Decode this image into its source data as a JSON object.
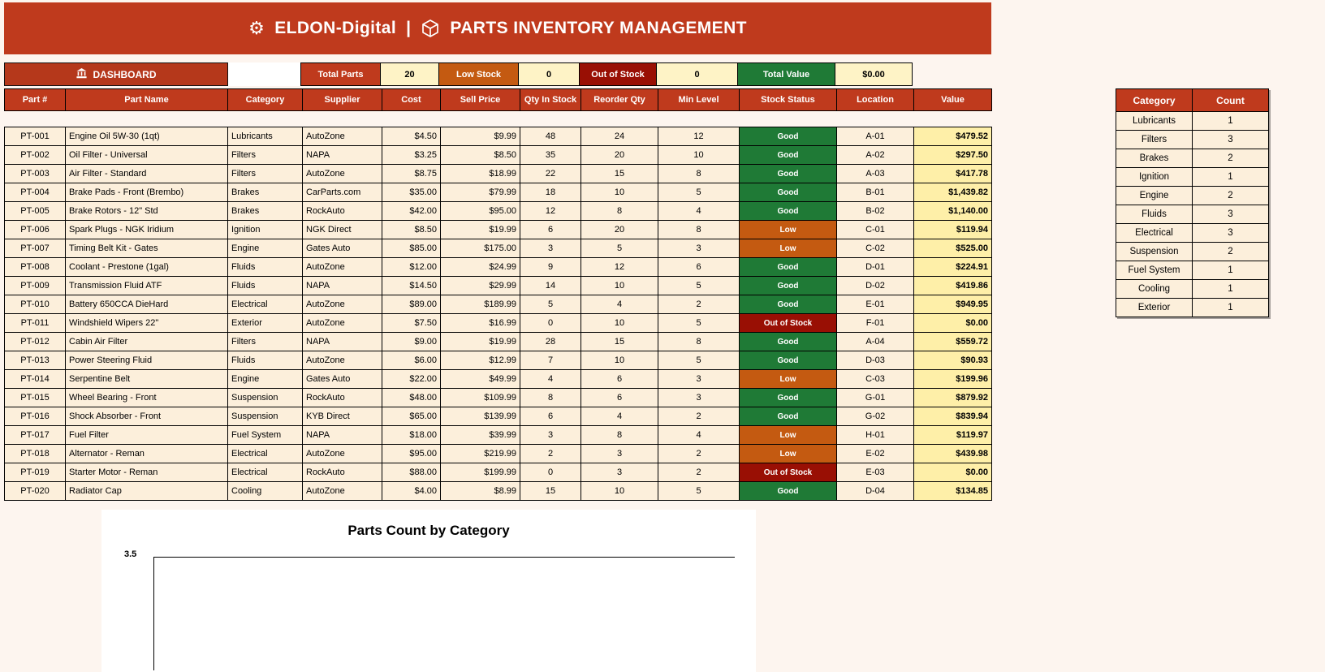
{
  "banner": {
    "app": "ELDON-Digital",
    "sep": "|",
    "title": "PARTS INVENTORY MANAGEMENT"
  },
  "icons": {
    "gear": "⚙",
    "package": "package-cube",
    "dashboard": "bank-building"
  },
  "dashboard": {
    "label": "DASHBOARD"
  },
  "kpis": [
    {
      "label": "Total Parts",
      "value": "20",
      "color": "#bf3a1d"
    },
    {
      "label": "Low Stock",
      "value": "0",
      "color": "#c45a11"
    },
    {
      "label": "Out of Stock",
      "value": "0",
      "color": "#990f04"
    },
    {
      "label": "Total Value",
      "value": "$0.00",
      "color": "#1f7a36"
    }
  ],
  "table": {
    "headers": [
      "Part #",
      "Part Name",
      "Category",
      "Supplier",
      "Cost",
      "Sell Price",
      "Qty In Stock",
      "Reorder Qty",
      "Min Level",
      "Stock Status",
      "Location",
      "Value"
    ],
    "rows": [
      {
        "part": "PT-001",
        "name": "Engine Oil 5W-30 (1qt)",
        "category": "Lubricants",
        "supplier": "AutoZone",
        "cost": "$4.50",
        "sell": "$9.99",
        "qty": 48,
        "reorder": 24,
        "min": 12,
        "status": "Good",
        "location": "A-01",
        "value": "$479.52"
      },
      {
        "part": "PT-002",
        "name": "Oil Filter - Universal",
        "category": "Filters",
        "supplier": "NAPA",
        "cost": "$3.25",
        "sell": "$8.50",
        "qty": 35,
        "reorder": 20,
        "min": 10,
        "status": "Good",
        "location": "A-02",
        "value": "$297.50"
      },
      {
        "part": "PT-003",
        "name": "Air Filter - Standard",
        "category": "Filters",
        "supplier": "AutoZone",
        "cost": "$8.75",
        "sell": "$18.99",
        "qty": 22,
        "reorder": 15,
        "min": 8,
        "status": "Good",
        "location": "A-03",
        "value": "$417.78"
      },
      {
        "part": "PT-004",
        "name": "Brake Pads - Front (Brembo)",
        "category": "Brakes",
        "supplier": "CarParts.com",
        "cost": "$35.00",
        "sell": "$79.99",
        "qty": 18,
        "reorder": 10,
        "min": 5,
        "status": "Good",
        "location": "B-01",
        "value": "$1,439.82"
      },
      {
        "part": "PT-005",
        "name": "Brake Rotors - 12\" Std",
        "category": "Brakes",
        "supplier": "RockAuto",
        "cost": "$42.00",
        "sell": "$95.00",
        "qty": 12,
        "reorder": 8,
        "min": 4,
        "status": "Good",
        "location": "B-02",
        "value": "$1,140.00"
      },
      {
        "part": "PT-006",
        "name": "Spark Plugs - NGK Iridium",
        "category": "Ignition",
        "supplier": "NGK Direct",
        "cost": "$8.50",
        "sell": "$19.99",
        "qty": 6,
        "reorder": 20,
        "min": 8,
        "status": "Low",
        "location": "C-01",
        "value": "$119.94"
      },
      {
        "part": "PT-007",
        "name": "Timing Belt Kit - Gates",
        "category": "Engine",
        "supplier": "Gates Auto",
        "cost": "$85.00",
        "sell": "$175.00",
        "qty": 3,
        "reorder": 5,
        "min": 3,
        "status": "Low",
        "location": "C-02",
        "value": "$525.00"
      },
      {
        "part": "PT-008",
        "name": "Coolant - Prestone (1gal)",
        "category": "Fluids",
        "supplier": "AutoZone",
        "cost": "$12.00",
        "sell": "$24.99",
        "qty": 9,
        "reorder": 12,
        "min": 6,
        "status": "Good",
        "location": "D-01",
        "value": "$224.91"
      },
      {
        "part": "PT-009",
        "name": "Transmission Fluid ATF",
        "category": "Fluids",
        "supplier": "NAPA",
        "cost": "$14.50",
        "sell": "$29.99",
        "qty": 14,
        "reorder": 10,
        "min": 5,
        "status": "Good",
        "location": "D-02",
        "value": "$419.86"
      },
      {
        "part": "PT-010",
        "name": "Battery 650CCA DieHard",
        "category": "Electrical",
        "supplier": "AutoZone",
        "cost": "$89.00",
        "sell": "$189.99",
        "qty": 5,
        "reorder": 4,
        "min": 2,
        "status": "Good",
        "location": "E-01",
        "value": "$949.95"
      },
      {
        "part": "PT-011",
        "name": "Windshield Wipers 22\"",
        "category": "Exterior",
        "supplier": "AutoZone",
        "cost": "$7.50",
        "sell": "$16.99",
        "qty": 0,
        "reorder": 10,
        "min": 5,
        "status": "Out of Stock",
        "location": "F-01",
        "value": "$0.00"
      },
      {
        "part": "PT-012",
        "name": "Cabin Air Filter",
        "category": "Filters",
        "supplier": "NAPA",
        "cost": "$9.00",
        "sell": "$19.99",
        "qty": 28,
        "reorder": 15,
        "min": 8,
        "status": "Good",
        "location": "A-04",
        "value": "$559.72"
      },
      {
        "part": "PT-013",
        "name": "Power Steering Fluid",
        "category": "Fluids",
        "supplier": "AutoZone",
        "cost": "$6.00",
        "sell": "$12.99",
        "qty": 7,
        "reorder": 10,
        "min": 5,
        "status": "Good",
        "location": "D-03",
        "value": "$90.93"
      },
      {
        "part": "PT-014",
        "name": "Serpentine Belt",
        "category": "Engine",
        "supplier": "Gates Auto",
        "cost": "$22.00",
        "sell": "$49.99",
        "qty": 4,
        "reorder": 6,
        "min": 3,
        "status": "Low",
        "location": "C-03",
        "value": "$199.96"
      },
      {
        "part": "PT-015",
        "name": "Wheel Bearing - Front",
        "category": "Suspension",
        "supplier": "RockAuto",
        "cost": "$48.00",
        "sell": "$109.99",
        "qty": 8,
        "reorder": 6,
        "min": 3,
        "status": "Good",
        "location": "G-01",
        "value": "$879.92"
      },
      {
        "part": "PT-016",
        "name": "Shock Absorber - Front",
        "category": "Suspension",
        "supplier": "KYB Direct",
        "cost": "$65.00",
        "sell": "$139.99",
        "qty": 6,
        "reorder": 4,
        "min": 2,
        "status": "Good",
        "location": "G-02",
        "value": "$839.94"
      },
      {
        "part": "PT-017",
        "name": "Fuel Filter",
        "category": "Fuel System",
        "supplier": "NAPA",
        "cost": "$18.00",
        "sell": "$39.99",
        "qty": 3,
        "reorder": 8,
        "min": 4,
        "status": "Low",
        "location": "H-01",
        "value": "$119.97"
      },
      {
        "part": "PT-018",
        "name": "Alternator - Reman",
        "category": "Electrical",
        "supplier": "AutoZone",
        "cost": "$95.00",
        "sell": "$219.99",
        "qty": 2,
        "reorder": 3,
        "min": 2,
        "status": "Low",
        "location": "E-02",
        "value": "$439.98"
      },
      {
        "part": "PT-019",
        "name": "Starter Motor - Reman",
        "category": "Electrical",
        "supplier": "RockAuto",
        "cost": "$88.00",
        "sell": "$199.99",
        "qty": 0,
        "reorder": 3,
        "min": 2,
        "status": "Out of Stock",
        "location": "E-03",
        "value": "$0.00"
      },
      {
        "part": "PT-020",
        "name": "Radiator Cap",
        "category": "Cooling",
        "supplier": "AutoZone",
        "cost": "$4.00",
        "sell": "$8.99",
        "qty": 15,
        "reorder": 10,
        "min": 5,
        "status": "Good",
        "location": "D-04",
        "value": "$134.85"
      }
    ]
  },
  "category_table": {
    "headers": [
      "Category",
      "Count"
    ],
    "rows": [
      {
        "category": "Lubricants",
        "count": 1
      },
      {
        "category": "Filters",
        "count": 3
      },
      {
        "category": "Brakes",
        "count": 2
      },
      {
        "category": "Ignition",
        "count": 1
      },
      {
        "category": "Engine",
        "count": 2
      },
      {
        "category": "Fluids",
        "count": 3
      },
      {
        "category": "Electrical",
        "count": 3
      },
      {
        "category": "Suspension",
        "count": 2
      },
      {
        "category": "Fuel System",
        "count": 1
      },
      {
        "category": "Cooling",
        "count": 1
      },
      {
        "category": "Exterior",
        "count": 1
      }
    ]
  },
  "chart": {
    "title": "Parts Count by Category",
    "tick": "3.5"
  },
  "colors": {
    "header_red": "#bf3a1d",
    "low_orange": "#c45a11",
    "out_red": "#990f04",
    "good_green": "#1f7a36",
    "row_cream": "#fcefdb",
    "value_yellow": "#feefa8",
    "kpi_value_bg": "#fef3c6"
  }
}
